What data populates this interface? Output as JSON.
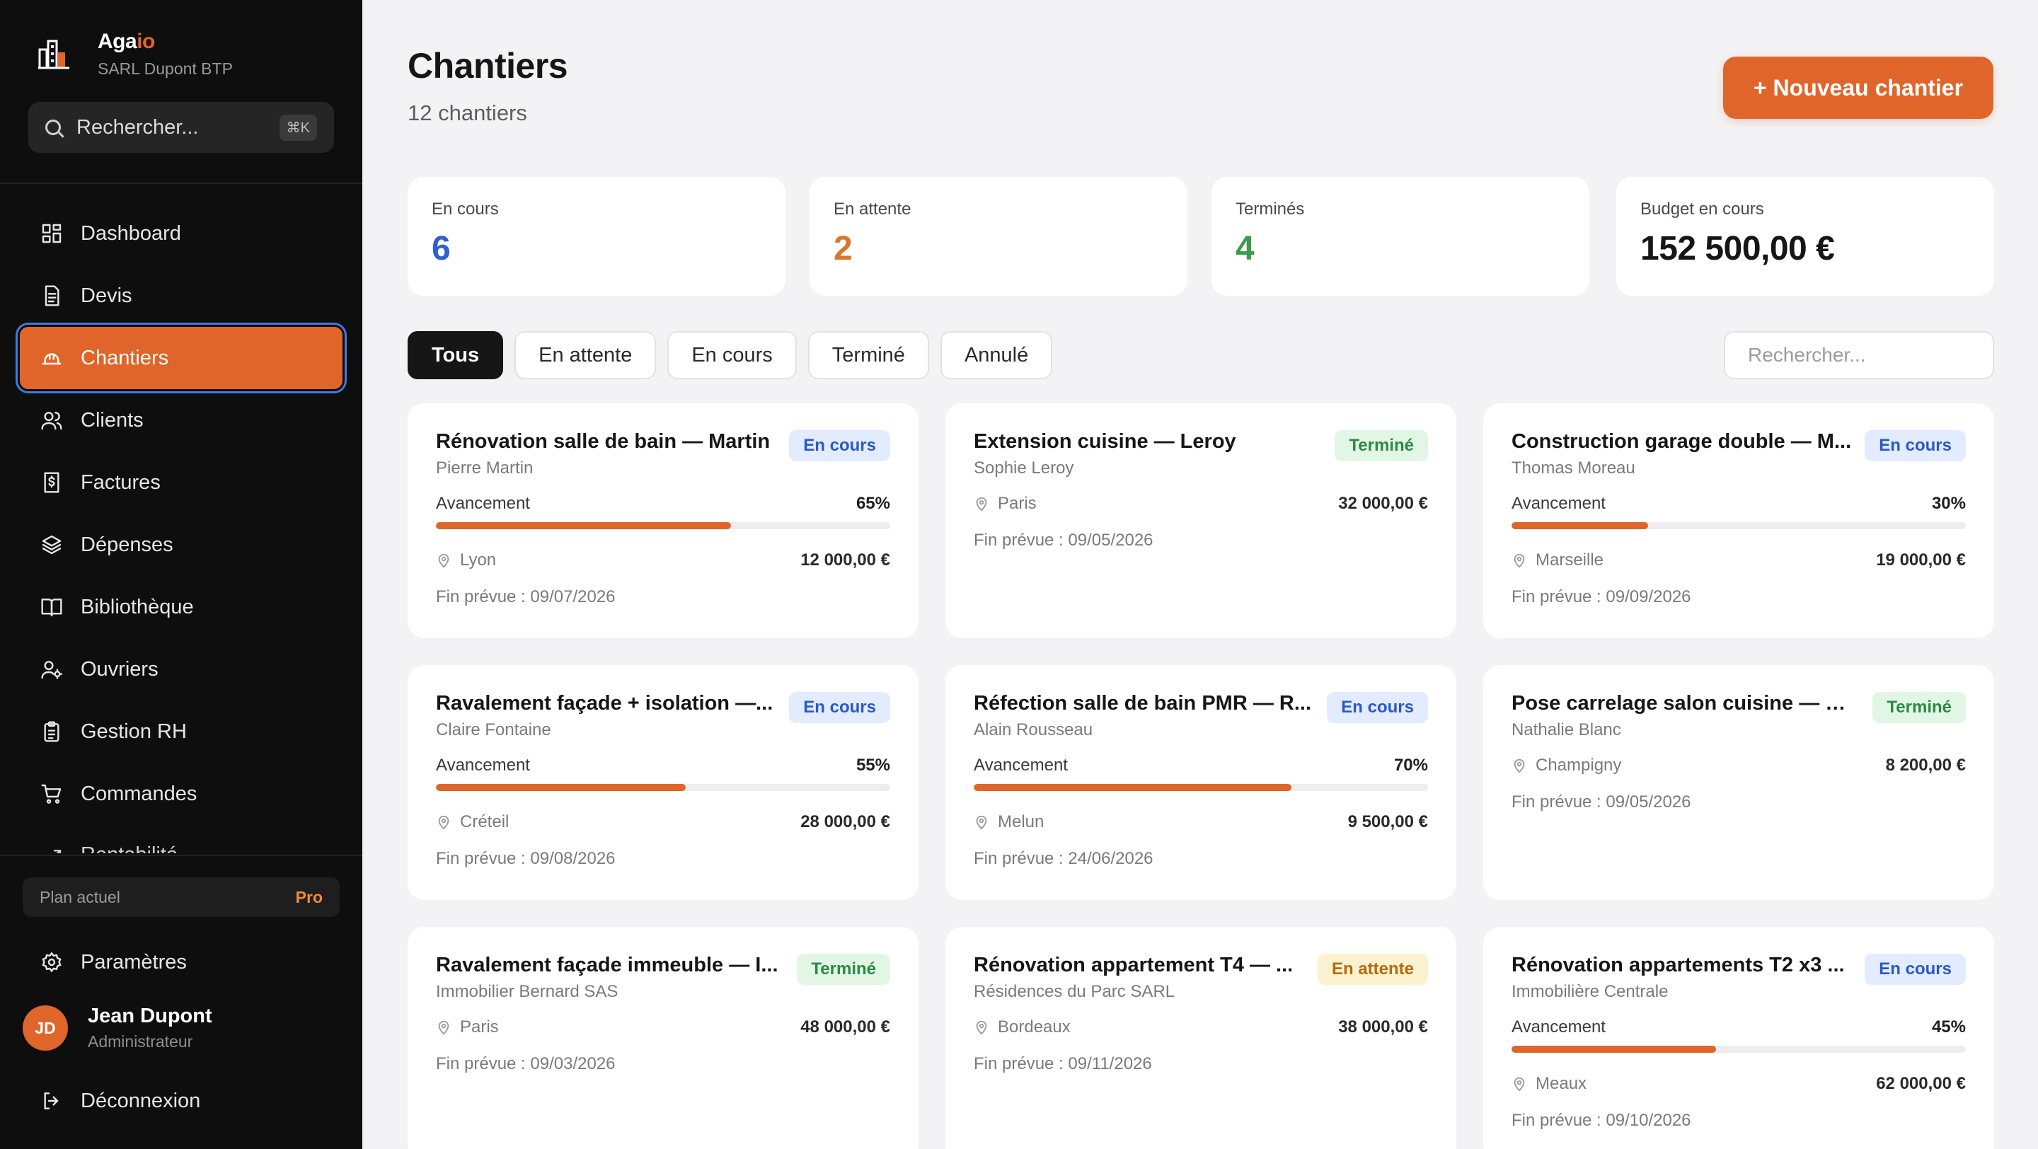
{
  "brand": {
    "name_main": "Aga",
    "name_accent": "io",
    "subtitle": "SARL Dupont BTP"
  },
  "sidebar": {
    "search_label": "Rechercher...",
    "search_shortcut": "⌘K",
    "items": [
      {
        "label": "Dashboard",
        "icon": "dashboard-grid-icon"
      },
      {
        "label": "Devis",
        "icon": "document-icon"
      },
      {
        "label": "Chantiers",
        "icon": "hard-hat-icon",
        "active": true
      },
      {
        "label": "Clients",
        "icon": "users-icon"
      },
      {
        "label": "Factures",
        "icon": "invoice-dollar-icon"
      },
      {
        "label": "Dépenses",
        "icon": "layers-icon"
      },
      {
        "label": "Bibliothèque",
        "icon": "book-open-icon"
      },
      {
        "label": "Ouvriers",
        "icon": "worker-icon"
      },
      {
        "label": "Gestion RH",
        "icon": "clipboard-icon"
      },
      {
        "label": "Commandes",
        "icon": "cart-icon"
      },
      {
        "label": "Rentabilité",
        "icon": "trend-icon"
      }
    ],
    "plan_label": "Plan actuel",
    "plan_value": "Pro",
    "settings_label": "Paramètres",
    "user": {
      "initials": "JD",
      "name": "Jean Dupont",
      "role": "Administrateur"
    },
    "logout_label": "Déconnexion"
  },
  "header": {
    "title": "Chantiers",
    "count": "12 chantiers",
    "new_button": "+ Nouveau chantier"
  },
  "stats": [
    {
      "label": "En cours",
      "value": "6",
      "color": "#2f5fd0"
    },
    {
      "label": "En attente",
      "value": "2",
      "color": "#d9782a"
    },
    {
      "label": "Terminés",
      "value": "4",
      "color": "#3b9a4e"
    },
    {
      "label": "Budget en cours",
      "value": "152 500,00 €",
      "color": "#161616"
    }
  ],
  "filters": {
    "tabs": [
      "Tous",
      "En attente",
      "En cours",
      "Terminé",
      "Annulé"
    ],
    "active": "Tous",
    "search_placeholder": "Rechercher..."
  },
  "labels": {
    "progress": "Avancement",
    "due_prefix": "Fin prévue : "
  },
  "status_colors": {
    "En cours": "blue",
    "Terminé": "green",
    "En attente": "yellow"
  },
  "projects": [
    {
      "title": "Rénovation salle de bain — Martin",
      "client": "Pierre Martin",
      "status": "En cours",
      "progress": 65,
      "progress_label": "65%",
      "location": "Lyon",
      "amount": "12 000,00 €",
      "due": "Fin prévue : 09/07/2026"
    },
    {
      "title": "Extension cuisine — Leroy",
      "client": "Sophie Leroy",
      "status": "Terminé",
      "progress": null,
      "progress_label": "",
      "location": "Paris",
      "amount": "32 000,00 €",
      "due": "Fin prévue : 09/05/2026"
    },
    {
      "title": "Construction garage double — M...",
      "client": "Thomas Moreau",
      "status": "En cours",
      "progress": 30,
      "progress_label": "30%",
      "location": "Marseille",
      "amount": "19 000,00 €",
      "due": "Fin prévue : 09/09/2026"
    },
    {
      "title": "Ravalement façade + isolation —...",
      "client": "Claire Fontaine",
      "status": "En cours",
      "progress": 55,
      "progress_label": "55%",
      "location": "Créteil",
      "amount": "28 000,00 €",
      "due": "Fin prévue : 09/08/2026"
    },
    {
      "title": "Réfection salle de bain PMR — R...",
      "client": "Alain Rousseau",
      "status": "En cours",
      "progress": 70,
      "progress_label": "70%",
      "location": "Melun",
      "amount": "9 500,00 €",
      "due": "Fin prévue : 24/06/2026"
    },
    {
      "title": "Pose carrelage salon cuisine — B...",
      "client": "Nathalie Blanc",
      "status": "Terminé",
      "progress": null,
      "progress_label": "",
      "location": "Champigny",
      "amount": "8 200,00 €",
      "due": "Fin prévue : 09/05/2026"
    },
    {
      "title": "Ravalement façade immeuble — I...",
      "client": "Immobilier Bernard SAS",
      "status": "Terminé",
      "progress": null,
      "progress_label": "",
      "location": "Paris",
      "amount": "48 000,00 €",
      "due": "Fin prévue : 09/03/2026"
    },
    {
      "title": "Rénovation appartement T4 — ...",
      "client": "Résidences du Parc SARL",
      "status": "En attente",
      "progress": null,
      "progress_label": "",
      "location": "Bordeaux",
      "amount": "38 000,00 €",
      "due": "Fin prévue : 09/11/2026"
    },
    {
      "title": "Rénovation appartements T2 x3 ...",
      "client": "Immobilière Centrale",
      "status": "En cours",
      "progress": 45,
      "progress_label": "45%",
      "location": "Meaux",
      "amount": "62 000,00 €",
      "due": "Fin prévue : 09/10/2026"
    }
  ]
}
